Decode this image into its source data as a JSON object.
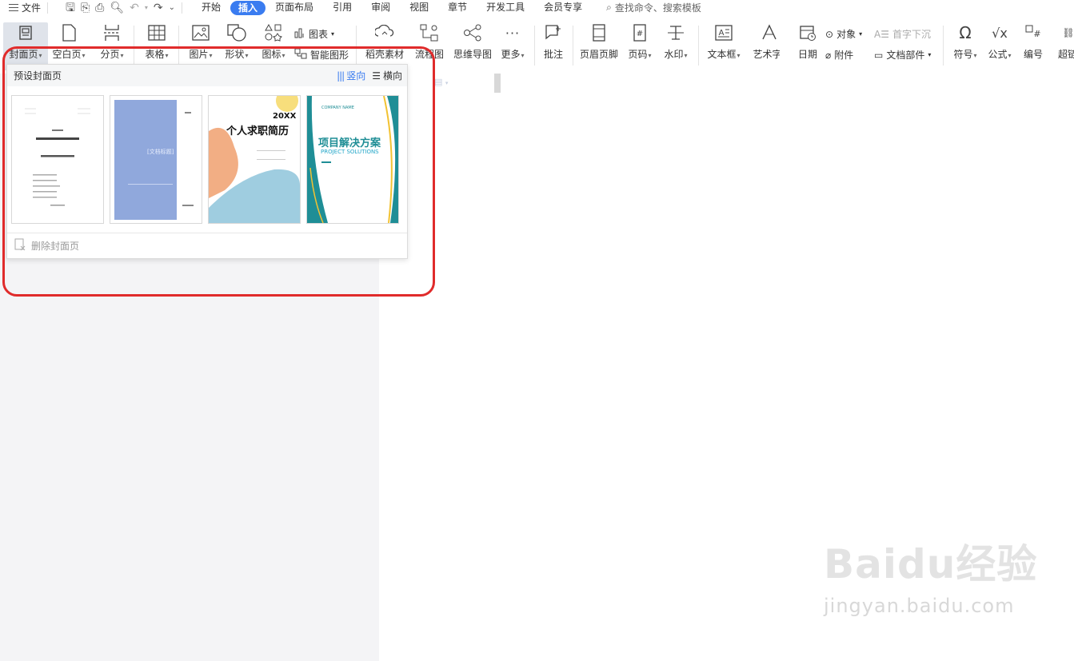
{
  "menubar": {
    "file_label": "文件",
    "tabs": [
      "开始",
      "插入",
      "页面布局",
      "引用",
      "审阅",
      "视图",
      "章节",
      "开发工具",
      "会员专享"
    ],
    "active_tab": "插入",
    "search_placeholder": "查找命令、搜索模板"
  },
  "ribbon": {
    "cover": "封面页",
    "blank": "空白页",
    "break": "分页",
    "table": "表格",
    "picture": "图片",
    "shape": "形状",
    "icon": "图标",
    "chart": "图表",
    "smartart": "智能图形",
    "daoke": "稻壳素材",
    "flow": "流程图",
    "mindmap": "思维导图",
    "more": "更多",
    "comment": "批注",
    "header_footer": "页眉页脚",
    "pagenum": "页码",
    "watermark": "水印",
    "textbox": "文本框",
    "wordart": "艺术字",
    "date": "日期",
    "object": "对象",
    "attachment": "附件",
    "dropcap": "首字下沉",
    "docparts": "文档部件",
    "symbol": "符号",
    "formula": "公式",
    "numbering": "编号",
    "hyperlink": "超链"
  },
  "cover_panel": {
    "title": "预设封面页",
    "portrait": "竖向",
    "landscape": "横向",
    "delete_label": "删除封面页",
    "thumb2_title": "[文档标题]",
    "thumb3_year": "20XX",
    "thumb3_title": "个人求职简历",
    "thumb4_company": "COMPANY NAME",
    "thumb4_title": "项目解决方案",
    "thumb4_sub": "PROJECT SOLUTIONS"
  },
  "watermark": {
    "brand": "Baidu经验",
    "url": "jingyan.baidu.com"
  },
  "colors": {
    "accent": "#3a7cf0",
    "highlight_border": "#e02b2b"
  }
}
